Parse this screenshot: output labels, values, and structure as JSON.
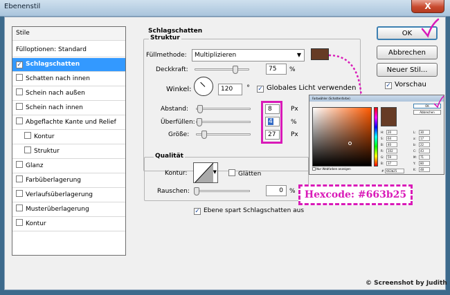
{
  "window": {
    "title": "Ebenenstil",
    "close_glyph": "X"
  },
  "stile_panel": {
    "header": "Stile",
    "items": [
      {
        "label": "Fülloptionen: Standard",
        "checkbox": false,
        "checked": false,
        "selected": false,
        "indent": 0
      },
      {
        "label": "Schlagschatten",
        "checkbox": true,
        "checked": true,
        "selected": true,
        "indent": 0
      },
      {
        "label": "Schatten nach innen",
        "checkbox": true,
        "checked": false,
        "selected": false,
        "indent": 0
      },
      {
        "label": "Schein nach außen",
        "checkbox": true,
        "checked": false,
        "selected": false,
        "indent": 0
      },
      {
        "label": "Schein nach innen",
        "checkbox": true,
        "checked": false,
        "selected": false,
        "indent": 0
      },
      {
        "label": "Abgeflachte Kante und Relief",
        "checkbox": true,
        "checked": false,
        "selected": false,
        "indent": 0
      },
      {
        "label": "Kontur",
        "checkbox": true,
        "checked": false,
        "selected": false,
        "indent": 1
      },
      {
        "label": "Struktur",
        "checkbox": true,
        "checked": false,
        "selected": false,
        "indent": 1
      },
      {
        "label": "Glanz",
        "checkbox": true,
        "checked": false,
        "selected": false,
        "indent": 0
      },
      {
        "label": "Farbüberlagerung",
        "checkbox": true,
        "checked": false,
        "selected": false,
        "indent": 0
      },
      {
        "label": "Verlaufsüberlagerung",
        "checkbox": true,
        "checked": false,
        "selected": false,
        "indent": 0
      },
      {
        "label": "Musterüberlagerung",
        "checkbox": true,
        "checked": false,
        "selected": false,
        "indent": 0
      },
      {
        "label": "Kontur",
        "checkbox": true,
        "checked": false,
        "selected": false,
        "indent": 0
      }
    ]
  },
  "schlagschatten": {
    "title": "Schlagschatten",
    "struktur_title": "Struktur",
    "fuellmethode_label": "Füllmethode:",
    "fuellmethode_value": "Multiplizieren",
    "color_swatch": "#663b25",
    "deckkraft_label": "Deckkraft:",
    "deckkraft_value": "75",
    "deckkraft_level": 0.75,
    "deckkraft_unit": "%",
    "winkel_label": "Winkel:",
    "winkel_value": "120",
    "winkel_unit": "°",
    "globales_licht_label": "Globales Licht verwenden",
    "globales_licht_checked": true,
    "abstand_label": "Abstand:",
    "abstand_value": "8",
    "abstand_unit": "Px",
    "ueberfuellen_label": "Überfüllen:",
    "ueberfuellen_value": "4",
    "ueberfuellen_unit": "%",
    "groesse_label": "Größe:",
    "groesse_value": "27",
    "groesse_unit": "Px"
  },
  "qualitaet": {
    "title": "Qualität",
    "kontur_label": "Kontur:",
    "glaetten_label": "Glätten",
    "rauschen_label": "Rauschen:",
    "rauschen_value": "0",
    "rauschen_level": 0.0,
    "rauschen_unit": "%",
    "ebene_spart_label": "Ebene spart Schlagschatten aus",
    "ebene_spart_checked": true
  },
  "buttons": {
    "ok": "OK",
    "abbrechen": "Abbrechen",
    "neuer_stil": "Neuer Stil...",
    "vorschau": "Vorschau",
    "vorschau_checked": true
  },
  "color_picker": {
    "title": "Farbwähler (Schattenfarbe)",
    "selected_color": "#663b25",
    "ok": "OK",
    "abbrechen": "Abbrechen",
    "nur_webfarben": "Nur Webfarben anzeigen",
    "fields": [
      {
        "label": "H:",
        "value": "20"
      },
      {
        "label": "S:",
        "value": "64"
      },
      {
        "label": "B:",
        "value": "40"
      },
      {
        "label": "R:",
        "value": "102"
      },
      {
        "label": "G:",
        "value": "59"
      },
      {
        "label": "B:",
        "value": "37"
      },
      {
        "label": "L:",
        "value": "30"
      },
      {
        "label": "a:",
        "value": "17"
      },
      {
        "label": "b:",
        "value": "22"
      },
      {
        "label": "C:",
        "value": "43"
      },
      {
        "label": "M:",
        "value": "71"
      },
      {
        "label": "Y:",
        "value": "80"
      },
      {
        "label": "K:",
        "value": "48"
      }
    ],
    "hex_label": "#",
    "hex_value": "663b25"
  },
  "annotation": {
    "hexcode": "Hexcode: #663b25",
    "highlight_color": "#d91ab8"
  },
  "watermark": "© Screenshot by Judith"
}
